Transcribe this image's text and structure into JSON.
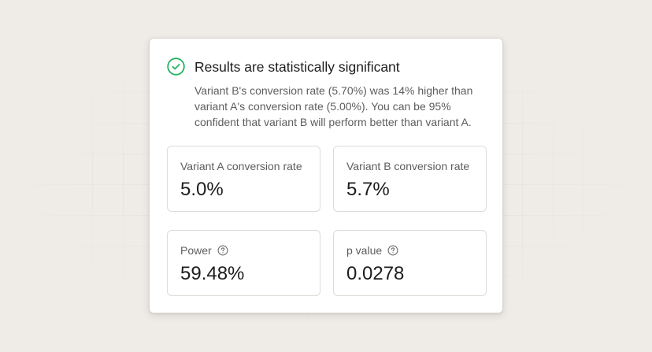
{
  "result": {
    "title": "Results are statistically significant",
    "status_icon": "check-circle-icon",
    "status_color": "#22b35e",
    "description_lines": [
      "Variant B's conversion rate (5.70%) was 14% higher than",
      "variant A's conversion rate (5.00%). You can be 95%",
      "confident that variant B will perform better than variant A."
    ]
  },
  "stats": {
    "variant_a": {
      "label": "Variant A conversion rate",
      "value": "5.0%"
    },
    "variant_b": {
      "label": "Variant B conversion rate",
      "value": "5.7%"
    },
    "power": {
      "label": "Power",
      "value": "59.48%",
      "icon": "question-circle-icon"
    },
    "p_value": {
      "label": "p value",
      "value": "0.0278",
      "icon": "question-circle-icon"
    }
  }
}
